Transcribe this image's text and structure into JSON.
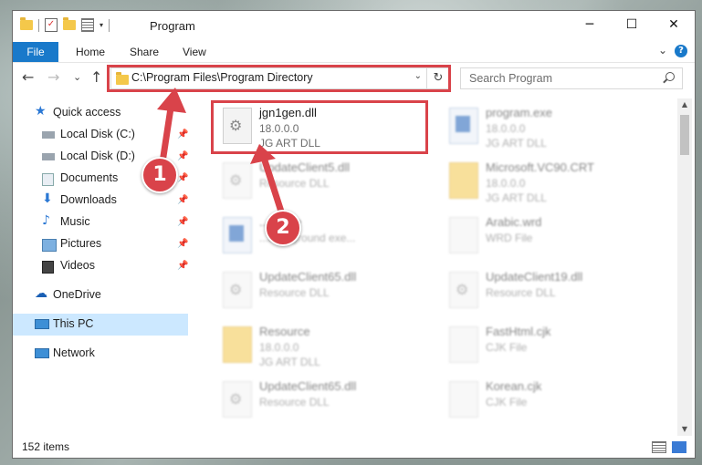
{
  "window": {
    "title": "Program",
    "minimize_glyph": "─",
    "maximize_glyph": "☐",
    "close_glyph": "✕"
  },
  "quick_access_toolbar": {
    "icons": [
      "folder-icon",
      "properties-check-icon",
      "new-folder-icon",
      "properties-icon",
      "customize-dropdown-icon"
    ]
  },
  "ribbon": {
    "tabs": [
      "File",
      "Home",
      "Share",
      "View"
    ],
    "help_glyph": "?",
    "expand_glyph": "⌄"
  },
  "navigation": {
    "back_glyph": "←",
    "forward_glyph": "→",
    "recent_glyph": "⌄",
    "up_glyph": "↑",
    "address": "C:\\Program Files\\Program Directory",
    "address_dropdown_glyph": "⌄",
    "refresh_glyph": "↻",
    "search_placeholder": "Search Program"
  },
  "sidebar": {
    "quick_access": "Quick access",
    "items": [
      {
        "label": "Local Disk (C:)",
        "icon": "drive-icon"
      },
      {
        "label": "Local Disk (D:)",
        "icon": "drive-icon"
      },
      {
        "label": "Documents",
        "icon": "documents-icon"
      },
      {
        "label": "Downloads",
        "icon": "downloads-icon"
      },
      {
        "label": "Music",
        "icon": "music-icon"
      },
      {
        "label": "Pictures",
        "icon": "pictures-icon"
      },
      {
        "label": "Videos",
        "icon": "videos-icon"
      }
    ],
    "onedrive": "OneDrive",
    "this_pc": "This PC",
    "network": "Network",
    "pin_glyph": "📌"
  },
  "files": [
    {
      "name": "jgn1gen.dll",
      "line2": "18.0.0.0",
      "line3": "JG ART DLL",
      "icon": "dll-gear-icon",
      "highlighted": true
    },
    {
      "name": "program.exe",
      "line2": "18.0.0.0",
      "line3": "JG ART DLL",
      "icon": "exe-icon"
    },
    {
      "name": "UpdateClient5.dll",
      "line2": "Resource DLL",
      "line3": "",
      "icon": "dll-gear-icon"
    },
    {
      "name": "Microsoft.VC90.CRT",
      "line2": "18.0.0.0",
      "line3": "JG ART DLL",
      "icon": "folder-icon"
    },
    {
      "name": "...rc.exe",
      "line2": "...background exe...",
      "line3": "",
      "icon": "app-icon"
    },
    {
      "name": "Arabic.wrd",
      "line2": "WRD File",
      "line3": "",
      "icon": "file-icon"
    },
    {
      "name": "UpdateClient65.dll",
      "line2": "Resource DLL",
      "line3": "",
      "icon": "dll-gear-icon"
    },
    {
      "name": "UpdateClient19.dll",
      "line2": "Resource DLL",
      "line3": "",
      "icon": "dll-gear-icon"
    },
    {
      "name": "Resource",
      "line2": "18.0.0.0",
      "line3": "JG ART DLL",
      "icon": "folder-icon"
    },
    {
      "name": "FastHtml.cjk",
      "line2": "CJK File",
      "line3": "",
      "icon": "file-icon"
    },
    {
      "name": "UpdateClient65.dll",
      "line2": "Resource DLL",
      "line3": "",
      "icon": "dll-gear-icon"
    },
    {
      "name": "Korean.cjk",
      "line2": "CJK File",
      "line3": "",
      "icon": "file-icon"
    }
  ],
  "status": {
    "item_count": "152 items"
  },
  "annotations": {
    "marker_1": "1",
    "marker_2": "2",
    "highlight_color": "#d9434a"
  }
}
